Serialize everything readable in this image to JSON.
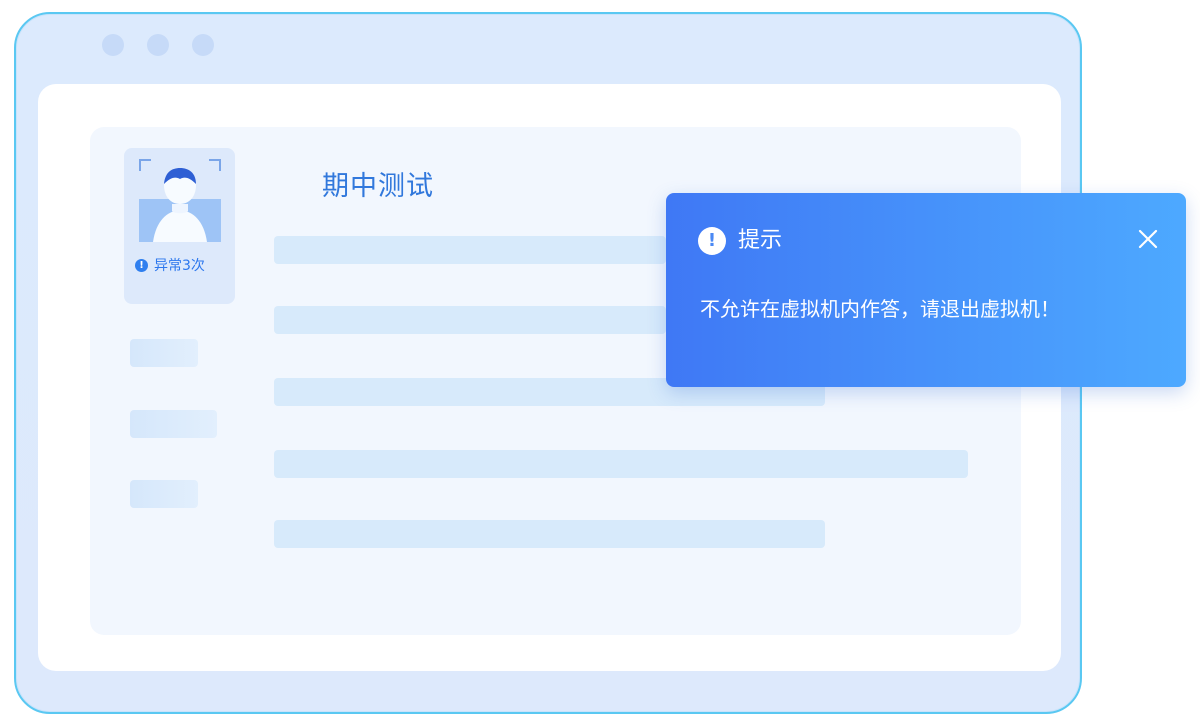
{
  "page": {
    "title": "期中测试"
  },
  "user_panel": {
    "warning_text": "异常3次"
  },
  "alert": {
    "title": "提示",
    "message": "不允许在虚拟机内作答，请退出虚拟机！",
    "icon": "exclamation-icon",
    "close_icon": "close-icon",
    "accent_color": "#3f78f5"
  }
}
